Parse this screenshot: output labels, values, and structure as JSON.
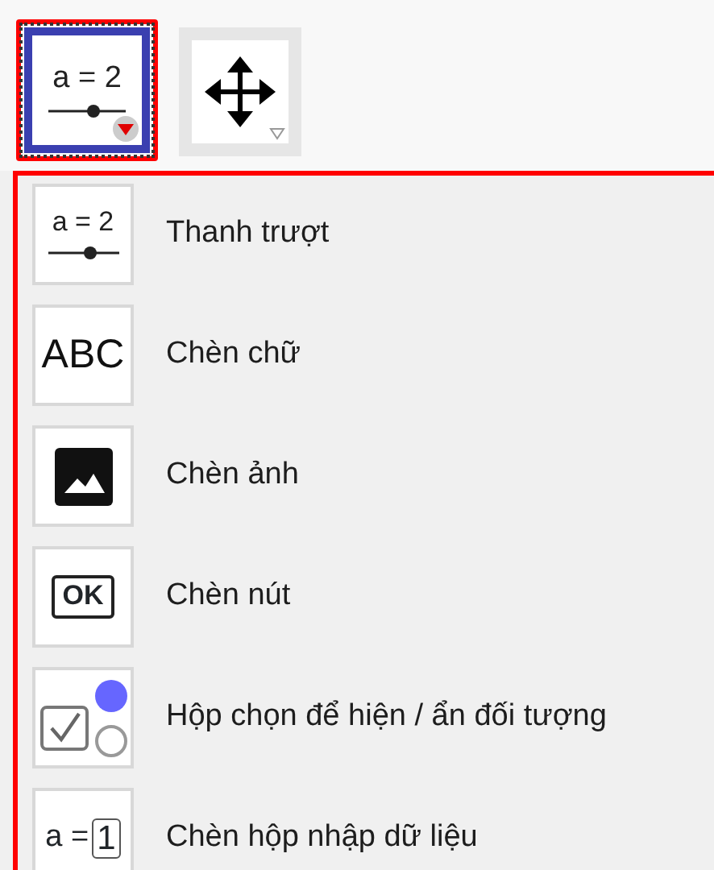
{
  "toolbar": {
    "tools": [
      {
        "kind": "slider",
        "icon_text": "a = 2",
        "selected": true,
        "highlighted": true
      },
      {
        "kind": "move",
        "selected": false,
        "highlighted": false
      }
    ]
  },
  "menu": {
    "highlighted": true,
    "items": [
      {
        "kind": "slider",
        "icon_text": "a = 2",
        "label": "Thanh trượt"
      },
      {
        "kind": "text",
        "icon_text": "ABC",
        "label": "Chèn chữ"
      },
      {
        "kind": "image",
        "label": "Chèn ảnh"
      },
      {
        "kind": "button",
        "icon_text": "OK",
        "label": "Chèn nút"
      },
      {
        "kind": "checkbox",
        "label": "Hộp chọn để hiện / ẩn đối tượng"
      },
      {
        "kind": "input",
        "icon_text": "a =",
        "icon_value": "1",
        "label": "Chèn hộp nhập dữ liệu"
      }
    ]
  }
}
